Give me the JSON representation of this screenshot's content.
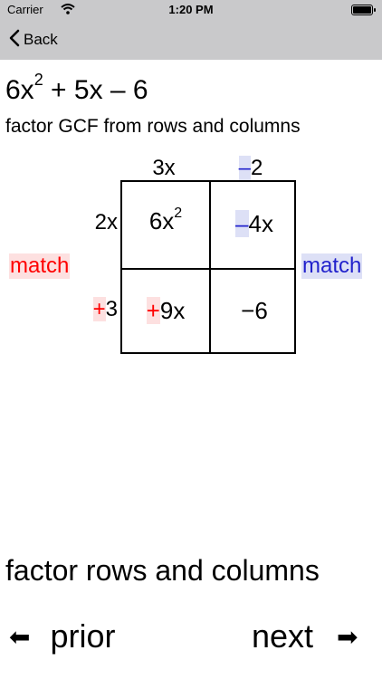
{
  "status": {
    "carrier": "Carrier",
    "time": "1:20 PM"
  },
  "nav": {
    "back_label": "Back"
  },
  "problem": {
    "expr_lead": "6x",
    "expr_exp": "2",
    "expr_rest": " + 5x – 6",
    "instruction": "factor GCF from rows and columns"
  },
  "grid": {
    "col_heads": [
      {
        "sign": "",
        "value": "3x"
      },
      {
        "sign": "–",
        "value": "2"
      }
    ],
    "row_heads": [
      {
        "sign": "",
        "value": "2x"
      },
      {
        "sign": "+",
        "value": "3"
      }
    ],
    "cells": [
      {
        "sign": "",
        "value": "6x",
        "exp": "2"
      },
      {
        "sign": "–",
        "value": "4x",
        "exp": ""
      },
      {
        "sign": "+",
        "value": "9x",
        "exp": ""
      },
      {
        "sign": "",
        "value": "−6",
        "exp": ""
      }
    ],
    "match_left": "match",
    "match_right": "match"
  },
  "footer": {
    "instruction": "factor rows and columns",
    "prior_label": "prior",
    "next_label": "next",
    "prior_arrow": "⬅",
    "next_arrow": "➡"
  },
  "colors": {
    "red": "#ff0000",
    "blue": "#2222cc",
    "bar": "#c9c9cb"
  }
}
